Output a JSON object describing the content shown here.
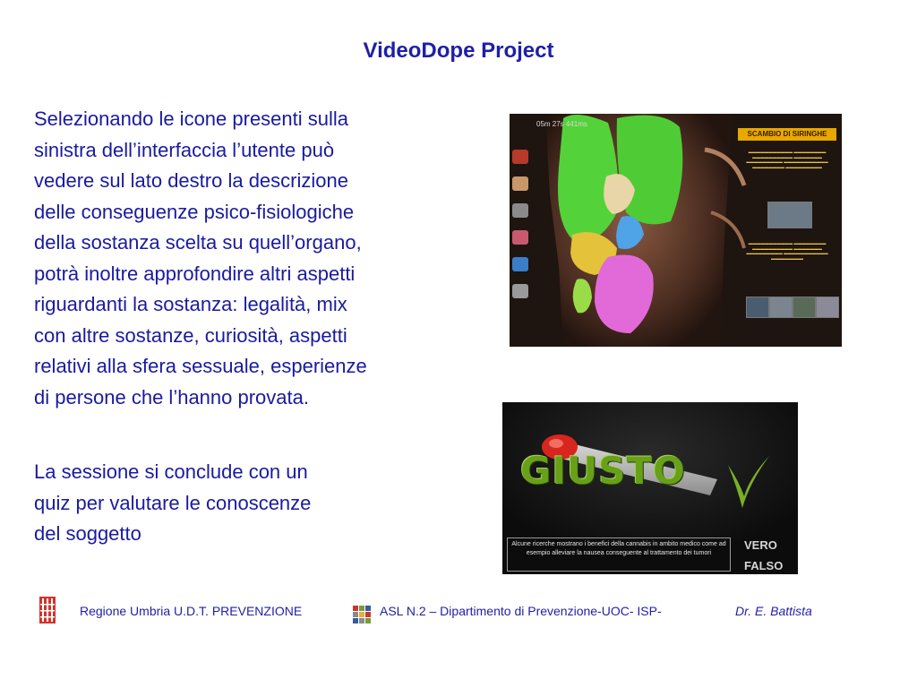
{
  "title": "VideoDope Project",
  "paragraph1": "Selezionando le icone presenti sulla\nsinistra dell’interfaccia l’utente può\nvedere sul lato destro la descrizione\ndelle conseguenze psico-fisiologiche\ndella sostanza scelta su quell’organo,\npotrà inoltre approfondire altri aspetti\nriguardanti la sostanza: legalità, mix\ncon altre sostanze, curiosità, aspetti\nrelativi alla sfera sessuale, esperienze\ndi persone che l’hanno provata.",
  "paragraph2": "La sessione si conclude con un\nquiz per valutare le conoscenze\ndel soggetto",
  "screenshot1": {
    "timer": "05m 27s 441ms",
    "banner": "SCAMBIO DI SIRINGHE"
  },
  "screenshot2": {
    "word": "GIUSTO",
    "info": "Alcune ricerche mostrano i benefici della cannabis in ambito medico come ad esempio alleviare la nausea conseguente al trattamento dei tumori",
    "vero": "VERO",
    "falso": "FALSO"
  },
  "footer": {
    "org1": "Regione Umbria U.D.T. PREVENZIONE",
    "org2": "ASL N.2 – Dipartimento di Prevenzione-UOC- ISP-",
    "author": "Dr.  E. Battista"
  }
}
